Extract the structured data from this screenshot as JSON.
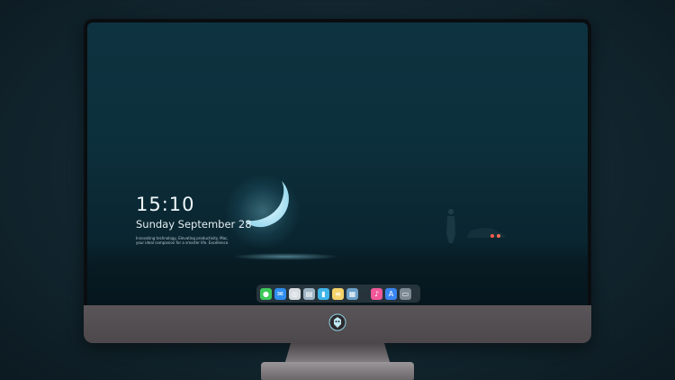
{
  "lock_screen": {
    "time": "15:10",
    "date": "Sunday September 28",
    "tagline": "Innovating technology, Elevating productivity. Mac, your ideal companion for a smarter life. Excellence."
  },
  "dock": {
    "apps": [
      {
        "name": "messages-icon",
        "color": "#3ec95a",
        "glyph": "●"
      },
      {
        "name": "mail-icon",
        "color": "#2f8ef0",
        "glyph": "✉"
      },
      {
        "name": "safari-icon",
        "color": "#d8dde2",
        "glyph": "◎"
      },
      {
        "name": "preview-icon",
        "color": "#9fb4c4",
        "glyph": "▤"
      },
      {
        "name": "final-cut-icon",
        "color": "#3fb4e8",
        "glyph": "▮"
      },
      {
        "name": "notes-icon",
        "color": "#f6d36a",
        "glyph": "≡"
      },
      {
        "name": "photos-icon",
        "color": "#6aa0c8",
        "glyph": "▦"
      },
      {
        "name": "music-icon",
        "color": "#f0589a",
        "glyph": "♪"
      },
      {
        "name": "app-store-icon",
        "color": "#3a86f2",
        "glyph": "A"
      },
      {
        "name": "trash-icon",
        "color": "#7d8a94",
        "glyph": "▭"
      }
    ]
  },
  "colors": {
    "screen_top": "#0e3340",
    "moon": "#bfeaf5",
    "monitor_chin": "#5a5558"
  }
}
